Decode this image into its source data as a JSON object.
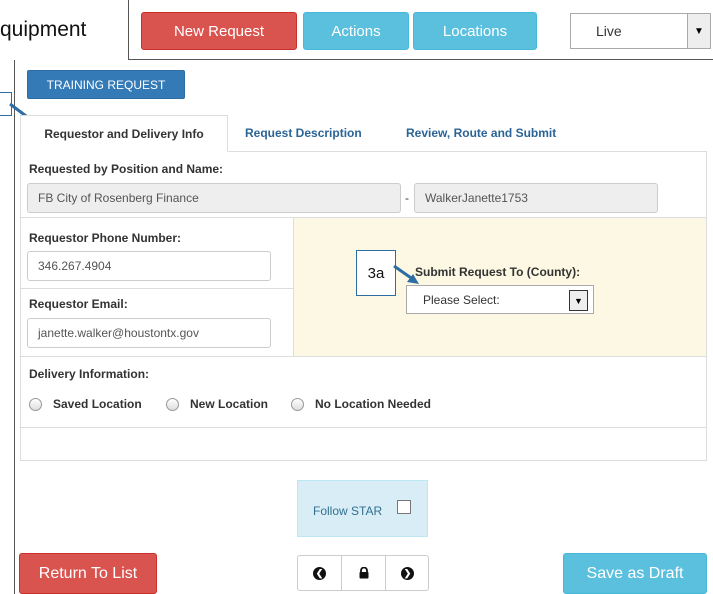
{
  "header": {
    "title_fragment": "quipment",
    "buttons": {
      "new_request": "New Request",
      "actions": "Actions",
      "locations": "Locations"
    },
    "environment_select": {
      "value": "Live",
      "icon": "dropdown-arrow-icon"
    }
  },
  "training_request_label": "TRAINING REQUEST",
  "callouts": {
    "badge_3a": "3a"
  },
  "tabs": [
    {
      "label": "Requestor and Delivery Info",
      "active": true
    },
    {
      "label": "Request Description",
      "active": false
    },
    {
      "label": "Review, Route and Submit",
      "active": false
    }
  ],
  "form": {
    "requested_by_label": "Requested by Position and Name:",
    "position_value": "FB City of Rosenberg Finance",
    "separator": "-",
    "name_value": "WalkerJanette1753",
    "phone_label": "Requestor Phone Number:",
    "phone_value": "346.267.4904",
    "email_label": "Requestor Email:",
    "email_value": "janette.walker@houstontx.gov",
    "submit_to_label": "Submit Request To (County):",
    "submit_to_value": "Please Select:",
    "delivery_label": "Delivery Information:",
    "delivery_options": [
      "Saved Location",
      "New Location",
      "No Location Needed"
    ]
  },
  "follow_star": {
    "label": "Follow STAR",
    "checked": false
  },
  "footer": {
    "return_label": "Return To List",
    "save_draft_label": "Save as Draft",
    "nav_icons": [
      "chevron-left-icon",
      "lock-icon",
      "chevron-right-icon"
    ]
  },
  "colors": {
    "danger": "#d9534f",
    "info": "#5bc0de",
    "primary": "#337ab7",
    "warning_bg": "#fcf8e3",
    "info_bg": "#d9edf7"
  }
}
